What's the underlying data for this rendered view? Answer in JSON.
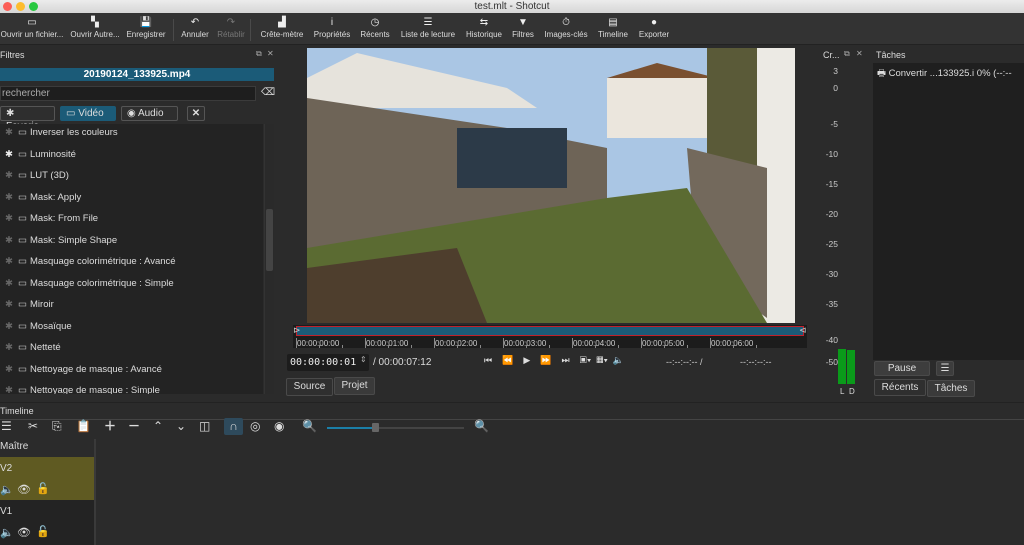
{
  "window": {
    "title": "test.mlt - Shotcut"
  },
  "toolbar": [
    {
      "label": "Ouvrir un fichier...",
      "icon": "folder-icon",
      "glyph": "▭"
    },
    {
      "label": "Ouvrir Autre...",
      "icon": "open-other-icon",
      "glyph": "▚"
    },
    {
      "label": "Enregistrer",
      "icon": "save-icon",
      "glyph": "💾"
    },
    {
      "label": "Annuler",
      "icon": "undo-icon",
      "glyph": "↶"
    },
    {
      "label": "Rétablir",
      "icon": "redo-icon",
      "glyph": "↷"
    },
    {
      "label": "Crête-mètre",
      "icon": "peak-meter-icon",
      "glyph": "▟"
    },
    {
      "label": "Propriétés",
      "icon": "info-icon",
      "glyph": "i"
    },
    {
      "label": "Récents",
      "icon": "clock-icon",
      "glyph": "◷"
    },
    {
      "label": "Liste de lecture",
      "icon": "list-icon",
      "glyph": "☰"
    },
    {
      "label": "Historique",
      "icon": "history-icon",
      "glyph": "⇆"
    },
    {
      "label": "Filtres",
      "icon": "filter-icon",
      "glyph": "▼"
    },
    {
      "label": "Images-clés",
      "icon": "stopwatch-icon",
      "glyph": "⏱"
    },
    {
      "label": "Timeline",
      "icon": "timeline-icon",
      "glyph": "▤"
    },
    {
      "label": "Exporter",
      "icon": "export-icon",
      "glyph": "●"
    }
  ],
  "filters": {
    "title": "Filtres",
    "clip": "20190124_133925.mp4",
    "search_placeholder": "rechercher",
    "tabs": {
      "favoris": "Favoris",
      "video": "Vidéo",
      "audio": "Audio"
    },
    "items": [
      "Inverser les couleurs",
      "Luminosité",
      "LUT (3D)",
      "Mask: Apply",
      "Mask: From File",
      "Mask: Simple Shape",
      "Masquage colorimétrique : Avancé",
      "Masquage colorimétrique : Simple",
      "Miroir",
      "Mosaïque",
      "Netteté",
      "Nettoyage de masque : Avancé",
      "Nettoyage de masque : Simple"
    ],
    "favorite_index": 1
  },
  "player": {
    "ruler": [
      "00:00:00:00",
      "00:00:01:00",
      "00:00:02:00",
      "00:00:03:00",
      "00:00:04:00",
      "00:00:05:00",
      "00:00:06:00"
    ],
    "position": "00:00:00:01",
    "duration": "/ 00:00:07:12",
    "in_out": "--:--:--:-- /",
    "out": "--:--:--:--",
    "tabs": [
      "Source",
      "Projet"
    ]
  },
  "meter": {
    "title": "Cr...",
    "scale": [
      "3",
      "0",
      "-5",
      "-10",
      "-15",
      "-20",
      "-25",
      "-30",
      "-35",
      "-40",
      "-50"
    ],
    "channels": [
      "L",
      "D"
    ]
  },
  "tasks": {
    "title": "Tâches",
    "job": "Convertir ...133925.i 0% (--:--",
    "pause": "Pause",
    "tabs": [
      "Récents",
      "Tâches"
    ]
  },
  "timeline": {
    "title": "Timeline",
    "master": "Maître",
    "tracks": [
      "V2",
      "V1"
    ],
    "zoom_level": 0.35
  },
  "colors": {
    "accent": "#1b5b78",
    "selected_track": "#5f5a22",
    "meter_green": "#0a9a1a"
  }
}
